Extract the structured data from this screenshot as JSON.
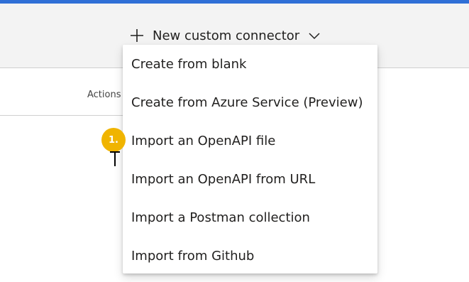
{
  "header": {
    "new_connector_label": "New custom connector",
    "accent_color": "#2f6fd6"
  },
  "table": {
    "actions_label": "Actions"
  },
  "dropdown": {
    "items": [
      {
        "label": "Create from blank"
      },
      {
        "label": "Create from Azure Service (Preview)"
      },
      {
        "label": "Import an OpenAPI file"
      },
      {
        "label": "Import an OpenAPI from URL"
      },
      {
        "label": "Import a Postman collection"
      },
      {
        "label": "Import from Github"
      }
    ]
  },
  "annotation": {
    "step_label": "1.",
    "badge_color": "#f0b400"
  },
  "icons": {
    "plus": "plus-icon",
    "chevron": "chevron-down-icon",
    "cursor": "text-cursor-icon"
  }
}
